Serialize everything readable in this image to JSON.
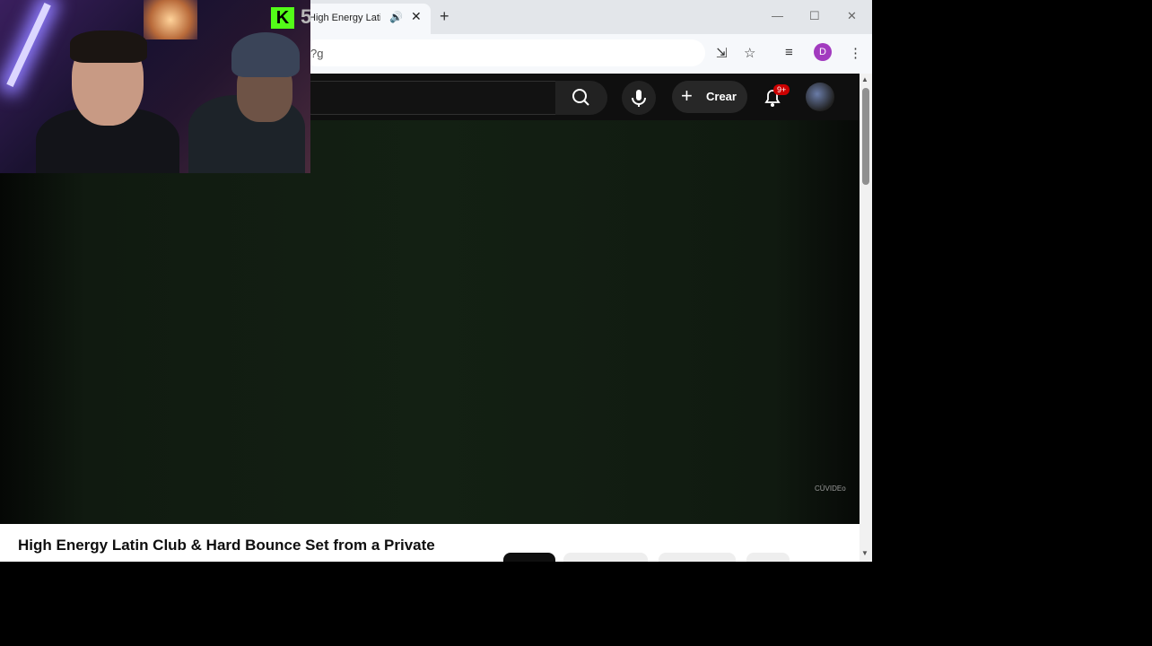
{
  "browser": {
    "tab_title": "High Energy Latin Club",
    "url_fragment": "?g"
  },
  "youtube": {
    "create_label": "Crear",
    "notif_badge": "9+",
    "video_title": "High Energy Latin Club & Hard Bounce Set from a Private",
    "watermark": "CÚVIDEo"
  },
  "overlay": {
    "channel_logo": "K",
    "channel_number": "5"
  },
  "colors": {
    "kick_green": "#53fc18",
    "youtube_red": "#cc0000"
  },
  "icons": [
    "audio-icon",
    "close-icon",
    "plus-icon",
    "minimize-icon",
    "maximize-icon",
    "window-close-icon",
    "install-icon",
    "star-icon",
    "media-control-icon",
    "kebab-menu-icon",
    "search-icon",
    "mic-icon",
    "bell-icon"
  ]
}
